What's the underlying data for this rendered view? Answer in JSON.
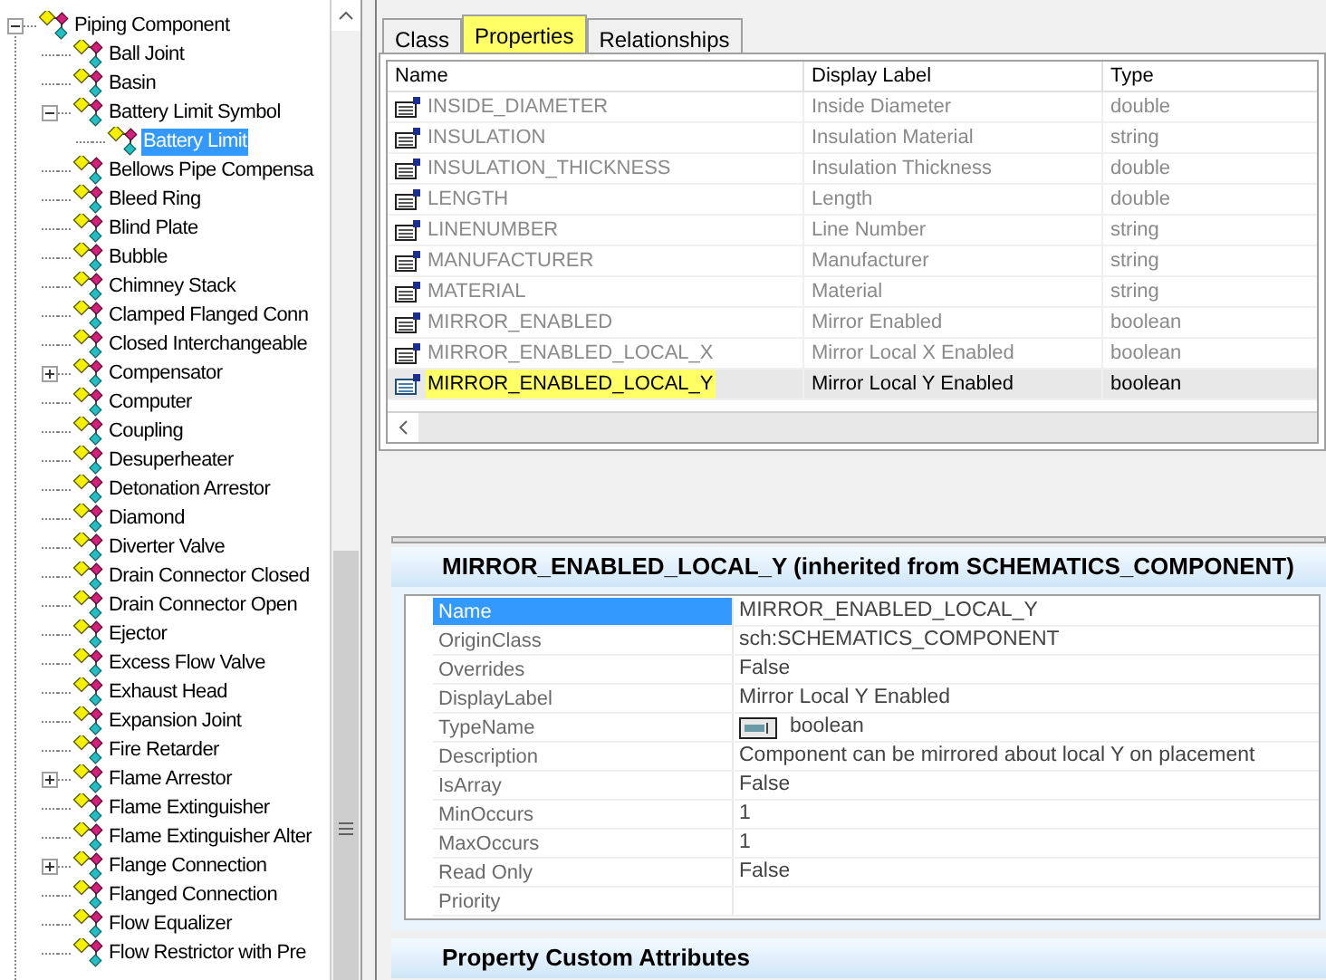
{
  "tree": {
    "label": "Piping Component",
    "kind": "expanded",
    "selected": false,
    "children": [
      {
        "label": "Ball Joint",
        "kind": "leaf",
        "selected": false
      },
      {
        "label": "Basin",
        "kind": "leaf",
        "selected": false
      },
      {
        "label": "Battery Limit Symbol",
        "kind": "expanded",
        "selected": false,
        "children": [
          {
            "label": "Battery Limit",
            "kind": "leaf",
            "selected": true
          }
        ]
      },
      {
        "label": "Bellows Pipe Compensa",
        "kind": "leaf",
        "selected": false
      },
      {
        "label": "Bleed Ring",
        "kind": "leaf",
        "selected": false
      },
      {
        "label": "Blind Plate",
        "kind": "leaf",
        "selected": false
      },
      {
        "label": "Bubble",
        "kind": "leaf",
        "selected": false
      },
      {
        "label": "Chimney Stack",
        "kind": "leaf",
        "selected": false
      },
      {
        "label": "Clamped Flanged Conn",
        "kind": "leaf",
        "selected": false
      },
      {
        "label": "Closed Interchangeable",
        "kind": "leaf",
        "selected": false
      },
      {
        "label": "Compensator",
        "kind": "collapsed",
        "selected": false
      },
      {
        "label": "Computer",
        "kind": "leaf",
        "selected": false
      },
      {
        "label": "Coupling",
        "kind": "leaf",
        "selected": false
      },
      {
        "label": "Desuperheater",
        "kind": "leaf",
        "selected": false
      },
      {
        "label": "Detonation Arrestor",
        "kind": "leaf",
        "selected": false
      },
      {
        "label": "Diamond",
        "kind": "leaf",
        "selected": false
      },
      {
        "label": "Diverter Valve",
        "kind": "leaf",
        "selected": false
      },
      {
        "label": "Drain Connector Closed",
        "kind": "leaf",
        "selected": false
      },
      {
        "label": "Drain Connector Open",
        "kind": "leaf",
        "selected": false
      },
      {
        "label": "Ejector",
        "kind": "leaf",
        "selected": false
      },
      {
        "label": "Excess Flow Valve",
        "kind": "leaf",
        "selected": false
      },
      {
        "label": "Exhaust Head",
        "kind": "leaf",
        "selected": false
      },
      {
        "label": "Expansion Joint",
        "kind": "leaf",
        "selected": false
      },
      {
        "label": "Fire Retarder",
        "kind": "leaf",
        "selected": false
      },
      {
        "label": "Flame Arrestor",
        "kind": "collapsed",
        "selected": false
      },
      {
        "label": "Flame Extinguisher",
        "kind": "leaf",
        "selected": false
      },
      {
        "label": "Flame Extinguisher Alter",
        "kind": "leaf",
        "selected": false
      },
      {
        "label": "Flange Connection",
        "kind": "collapsed",
        "selected": false
      },
      {
        "label": "Flanged Connection",
        "kind": "leaf",
        "selected": false
      },
      {
        "label": "Flow Equalizer",
        "kind": "leaf",
        "selected": false
      },
      {
        "label": "Flow Restrictor with Pre",
        "kind": "leaf",
        "selected": false
      }
    ]
  },
  "tabs": [
    {
      "label": "Class",
      "selected": false,
      "highlighted": false
    },
    {
      "label": "Properties",
      "selected": true,
      "highlighted": true
    },
    {
      "label": "Relationships",
      "selected": false,
      "highlighted": false
    }
  ],
  "table": {
    "columns": [
      "Name",
      "Display Label",
      "Type"
    ],
    "rows": [
      {
        "name": "INSIDE_DIAMETER",
        "display_label": "Inside Diameter",
        "type": "double",
        "selected": false,
        "highlighted": false
      },
      {
        "name": "INSULATION",
        "display_label": "Insulation Material",
        "type": "string",
        "selected": false,
        "highlighted": false
      },
      {
        "name": "INSULATION_THICKNESS",
        "display_label": "Insulation Thickness",
        "type": "double",
        "selected": false,
        "highlighted": false
      },
      {
        "name": "LENGTH",
        "display_label": "Length",
        "type": "double",
        "selected": false,
        "highlighted": false
      },
      {
        "name": "LINENUMBER",
        "display_label": "Line Number",
        "type": "string",
        "selected": false,
        "highlighted": false
      },
      {
        "name": "MANUFACTURER",
        "display_label": "Manufacturer",
        "type": "string",
        "selected": false,
        "highlighted": false
      },
      {
        "name": "MATERIAL",
        "display_label": "Material",
        "type": "string",
        "selected": false,
        "highlighted": false
      },
      {
        "name": "MIRROR_ENABLED",
        "display_label": "Mirror Enabled",
        "type": "boolean",
        "selected": false,
        "highlighted": false
      },
      {
        "name": "MIRROR_ENABLED_LOCAL_X",
        "display_label": "Mirror Local X Enabled",
        "type": "boolean",
        "selected": false,
        "highlighted": false
      },
      {
        "name": "MIRROR_ENABLED_LOCAL_Y",
        "display_label": "Mirror Local Y Enabled",
        "type": "boolean",
        "selected": true,
        "highlighted": true
      }
    ]
  },
  "details": {
    "title": "MIRROR_ENABLED_LOCAL_Y (inherited from SCHEMATICS_COMPONENT)",
    "rows": [
      {
        "label": "Name",
        "value": "MIRROR_ENABLED_LOCAL_Y",
        "selected": true,
        "kind": "text"
      },
      {
        "label": "OriginClass",
        "value": "sch:SCHEMATICS_COMPONENT",
        "selected": false,
        "kind": "text"
      },
      {
        "label": "Overrides",
        "value": "False",
        "selected": false,
        "kind": "text"
      },
      {
        "label": "DisplayLabel",
        "value": "Mirror Local Y Enabled",
        "selected": false,
        "kind": "text"
      },
      {
        "label": "TypeName",
        "value": "boolean",
        "selected": false,
        "kind": "type"
      },
      {
        "label": "Description",
        "value": "Component can be mirrored about local Y on placement",
        "selected": false,
        "kind": "text"
      },
      {
        "label": "IsArray",
        "value": "False",
        "selected": false,
        "kind": "text"
      },
      {
        "label": "MinOccurs",
        "value": "1",
        "selected": false,
        "kind": "text"
      },
      {
        "label": "MaxOccurs",
        "value": "1",
        "selected": false,
        "kind": "text"
      },
      {
        "label": "Read Only",
        "value": "False",
        "selected": false,
        "kind": "text"
      },
      {
        "label": "Priority",
        "selected": false,
        "kind": "text"
      }
    ]
  },
  "custom_attributes": {
    "title": "Property Custom Attributes"
  }
}
